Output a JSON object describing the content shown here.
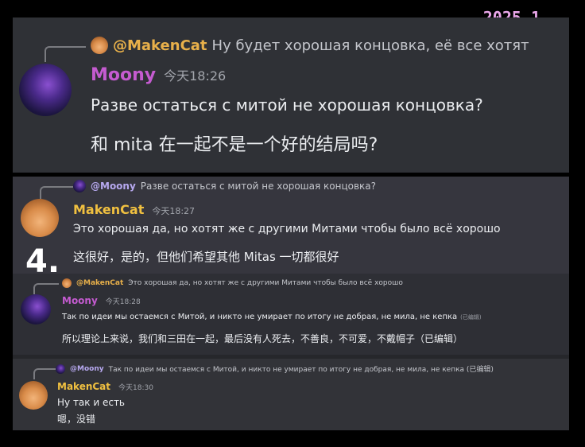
{
  "date_stamp": "2025.1",
  "step_number": "4.",
  "messages": [
    {
      "reply_to": {
        "name": "@MakenCat",
        "text": "Ну будет хорошая концовка, её все хотят"
      },
      "author": "Moony",
      "time": "今天18:26",
      "lines": [
        "Разве остаться с митой не хорошая концовка?",
        "和 mita 在一起不是一个好的结局吗?"
      ]
    },
    {
      "reply_to": {
        "name": "@Moony",
        "text": "Разве остаться с митой не хорошая концовка?"
      },
      "author": "MakenCat",
      "time": "今天18:27",
      "lines": [
        "Это хорошая да, но хотят же с другими Митами чтобы было всё хорошо",
        "这很好，是的，但他们希望其他 Mitas 一切都很好"
      ]
    },
    {
      "reply_to": {
        "name": "@MakenCat",
        "text": "Это хорошая да, но хотят же с другими Митами чтобы было всё хорошо"
      },
      "author": "Moony",
      "time": "今天18:28",
      "lines": [
        "Так по идеи мы остаемся с Митой, и никто не умирает по итогу  не добрая, не мила, не кепка",
        "所以理论上来说，我们和三田在一起，最后没有人死去，不善良，不可爱，不戴帽子（已编辑）"
      ],
      "edited_tag": "(已编辑)"
    },
    {
      "reply_to": {
        "name": "@Moony",
        "text": "Так по идеи мы остаемся с Митой, и никто не умирает по итогу  не добрая, не мила, не кепка (已编辑)"
      },
      "author": "MakenCat",
      "time": "今天18:30",
      "lines": [
        "Ну так и есть",
        "嗯，没错"
      ]
    }
  ],
  "colors": {
    "moony_name": "#c45bd0",
    "makencat_name": "#f0c040",
    "mention": "#b7a9f0",
    "date_stamp": "#e9a6e9"
  }
}
